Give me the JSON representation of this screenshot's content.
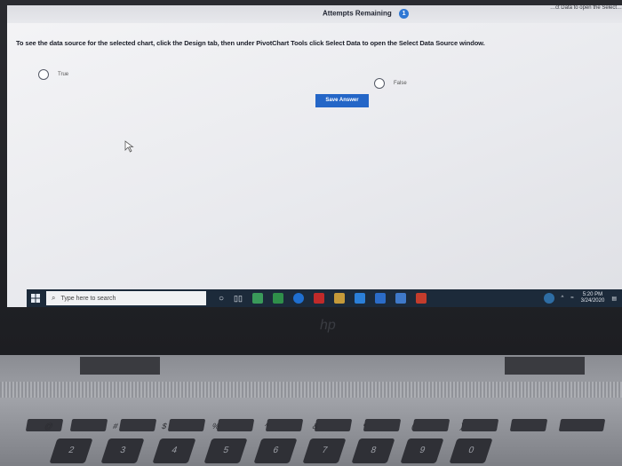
{
  "top_bar": {
    "edge_text": "…ct Data to open the Select…",
    "attempts_label": "Attempts Remaining",
    "attempts_count": "1"
  },
  "question": {
    "text": "To see the data source for the selected chart, click the Design tab, then under PivotChart Tools click Select Data to open the Select Data Source window."
  },
  "options": [
    {
      "label": "True"
    },
    {
      "label": "False"
    }
  ],
  "save_button": {
    "label": "Save Answer"
  },
  "taskbar": {
    "search_placeholder": "Type here to search",
    "clock_time": "5:20 PM",
    "clock_date": "3/24/2020"
  },
  "keyboard": {
    "number_keys": [
      "2",
      "3",
      "4",
      "5",
      "6",
      "7",
      "8",
      "9",
      "0"
    ],
    "symbol_keys": [
      "@",
      "#",
      "$",
      "%",
      "^",
      "&",
      "*",
      "(",
      ")"
    ]
  },
  "colors": {
    "accent": "#2466c7",
    "taskbar": "#1c2a3a",
    "badge": "#2f78d4"
  }
}
